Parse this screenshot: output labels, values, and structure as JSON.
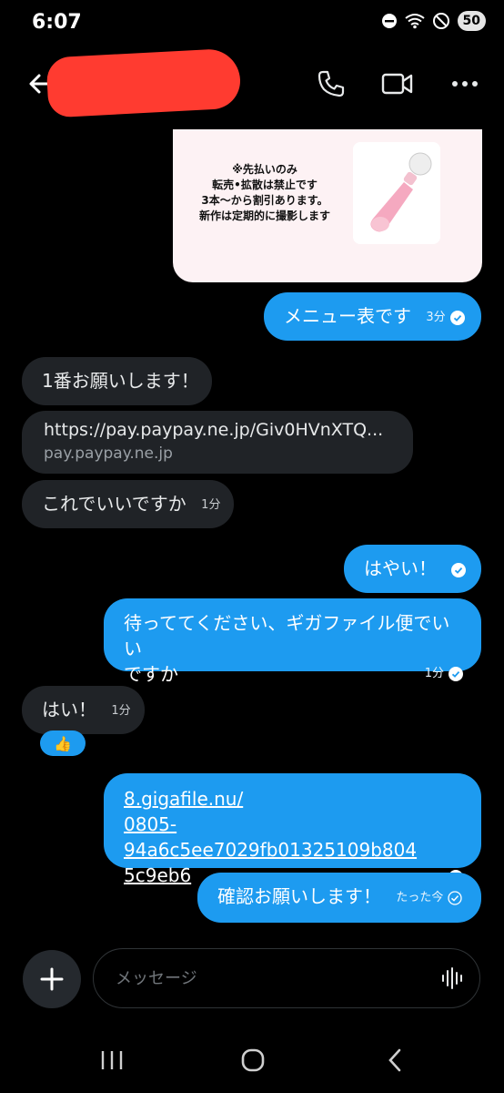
{
  "status_bar": {
    "time": "6:07",
    "battery": "50"
  },
  "header": {
    "back_icon": "arrow-left-icon",
    "call_icon": "phone-icon",
    "video_icon": "video-icon",
    "more_icon": "more-horizontal-icon"
  },
  "menu_card": {
    "lines": [
      "※先払いのみ",
      "転売•拡散は禁止です",
      "3本〜から割引あります。",
      "新作は定期的に撮影します"
    ]
  },
  "messages": [
    {
      "text": "メニュー表です",
      "time": "3分"
    },
    {
      "text": "1番お願いします！"
    },
    {
      "link_url": "https://pay.paypay.ne.jp/Giv0HVnXTQ...",
      "link_domain": "pay.paypay.ne.jp"
    },
    {
      "text": "これでいいですか",
      "time": "1分"
    },
    {
      "text": "はやい！"
    },
    {
      "line1": "待っててください、ギガファイル便でいい",
      "line2": "ですか",
      "time": "1分"
    },
    {
      "text": "はい！",
      "time": "1分",
      "reaction": "👍"
    },
    {
      "line1": "8.gigafile.nu/",
      "line2": "0805-94a6c5ee7029fb01325109b804",
      "line3": "5c9eb6"
    },
    {
      "text": "確認お願いします！",
      "time": "たった今"
    }
  ],
  "composer": {
    "placeholder": "メッセージ",
    "add_icon": "plus-icon",
    "voice_icon": "waveform-icon"
  },
  "nav_bar": {
    "recents_icon": "recents-icon",
    "home_icon": "home-icon",
    "back_icon": "back-chevron-icon"
  },
  "colors": {
    "accent": "#1d9bf0",
    "incoming": "#202327",
    "background": "#000000"
  }
}
